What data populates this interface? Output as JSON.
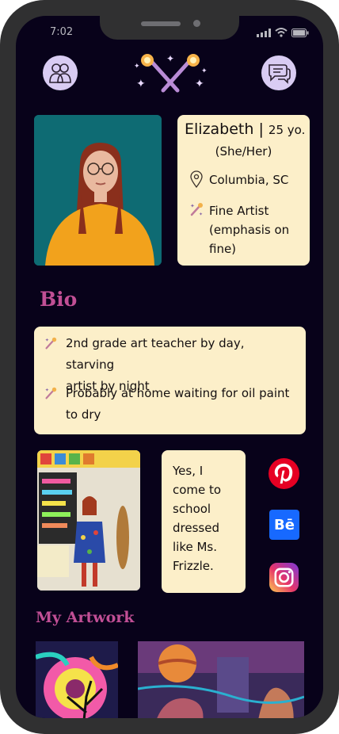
{
  "status_bar": {
    "time": "7:02"
  },
  "header": {
    "left_icon": "friends-icon",
    "center_logo": "crossed-paintbrushes-sparkles-logo",
    "right_icon": "chat-bubbles-icon"
  },
  "profile": {
    "name": "Elizabeth |",
    "age": "25 yo.",
    "pronouns": "(She/Her)",
    "location": "Columbia, SC",
    "occupation_lines": [
      "Fine Artist",
      "(emphasis on",
      "fine)"
    ]
  },
  "bio": {
    "heading": "Bio",
    "items": [
      {
        "lines": [
          "2nd grade art teacher by day, starving",
          "artist by night"
        ]
      },
      {
        "lines": [
          "Probably at home waiting for oil paint",
          "to dry"
        ]
      }
    ]
  },
  "classroom": {
    "quote_lines": [
      "Yes, I",
      "come to",
      "school",
      "dressed",
      "like Ms.",
      "Frizzle."
    ]
  },
  "social": {
    "items": [
      {
        "name": "pinterest-icon",
        "color": "#e60023"
      },
      {
        "name": "behance-icon",
        "color": "#1769ff",
        "label": "Bē"
      },
      {
        "name": "instagram-icon",
        "color": "#d6249f"
      }
    ]
  },
  "artwork": {
    "heading": "My Artwork"
  },
  "colors": {
    "screen_bg": "#08021a",
    "card_bg": "#fcefc9",
    "accent_pink": "#c14f95",
    "icon_bubble": "#d9ccf3",
    "portrait_bg": "#0e6b73"
  }
}
